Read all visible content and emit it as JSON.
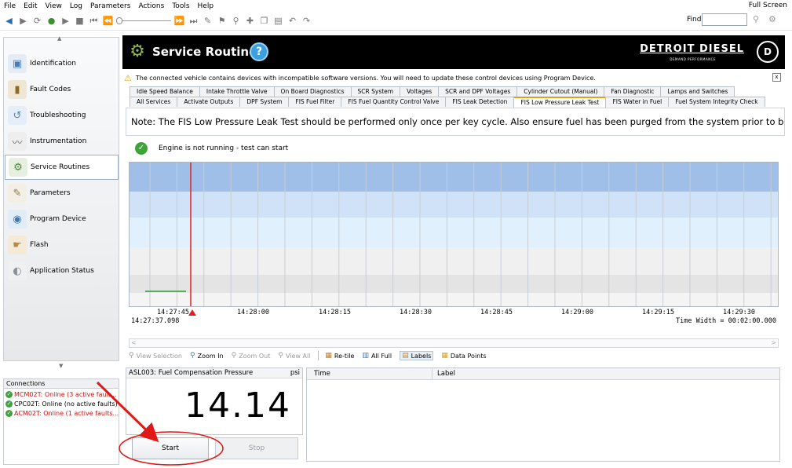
{
  "menu": {
    "items": [
      "File",
      "Edit",
      "View",
      "Log",
      "Parameters",
      "Actions",
      "Tools",
      "Help"
    ],
    "full_screen": "Full Screen"
  },
  "toolbar": {
    "find_label": "Find",
    "find_value": ""
  },
  "sidebar": {
    "items": [
      {
        "label": "Identification",
        "icon": "identification-icon"
      },
      {
        "label": "Fault Codes",
        "icon": "fault-codes-icon"
      },
      {
        "label": "Troubleshooting",
        "icon": "troubleshooting-icon"
      },
      {
        "label": "Instrumentation",
        "icon": "instrumentation-icon"
      },
      {
        "label": "Service Routines",
        "icon": "service-routines-icon",
        "selected": true
      },
      {
        "label": "Parameters",
        "icon": "parameters-icon"
      },
      {
        "label": "Program Device",
        "icon": "program-device-icon"
      },
      {
        "label": "Flash",
        "icon": "flash-icon"
      },
      {
        "label": "Application Status",
        "icon": "application-status-icon"
      }
    ]
  },
  "connections": {
    "title": "Connections",
    "items": [
      {
        "text": "MCM02T: Online (3 active fault...",
        "color": "#d01010"
      },
      {
        "text": "CPC02T: Online (no active faults)",
        "color": "#000000"
      },
      {
        "text": "ACM02T: Online (1 active faults...",
        "color": "#d01010"
      }
    ]
  },
  "header": {
    "title": "Service Routines",
    "help": "?",
    "brand": "DETROIT DIESEL",
    "tagline": "DEMAND PERFORMANCE"
  },
  "warning": {
    "text": "The connected vehicle contains devices with incompatible software versions.  You will need to update these control devices using Program Device.",
    "close": "x"
  },
  "tabs": {
    "row1": [
      "Idle Speed Balance",
      "Intake Throttle Valve",
      "On Board Diagnostics",
      "SCR System",
      "Voltages",
      "SCR and DPF Voltages",
      "Cylinder Cutout (Manual)",
      "Fan Diagnostic",
      "Lamps and Switches"
    ],
    "row2": [
      "All Services",
      "Activate Outputs",
      "DPF System",
      "FIS Fuel Filter",
      "FIS Fuel Quantity Control Valve",
      "FIS Leak Detection",
      "FIS Low Pressure Leak Test",
      "FIS Water in Fuel",
      "Fuel System Integrity Check"
    ],
    "active": "FIS Low Pressure Leak Test"
  },
  "note": "Note: The FIS Low Pressure Leak Test should be performed only once per key cycle. Also ensure fuel has been purged from the system prior to beginning the test.",
  "status": {
    "text": "Engine is not running - test can start"
  },
  "chart": {
    "ticks": [
      "14:27:45",
      "14:28:00",
      "14:28:15",
      "14:28:30",
      "14:28:45",
      "14:29:00",
      "14:29:15",
      "14:29:30"
    ],
    "start_time": "14:27:37.098",
    "time_width": "Time Width = 00:02:00.000",
    "bands": [
      "#9fbfe9",
      "#cfe2f8",
      "#e0f1fd",
      "#f0f0f0",
      "#e4e4e4",
      "#f4f4f4"
    ],
    "marker_color": "#e02020",
    "trace_color": "#2e9a2e"
  },
  "chart_toolbar": {
    "view_selection": "View Selection",
    "zoom_in": "Zoom In",
    "zoom_out": "Zoom Out",
    "view_all": "View All",
    "retile": "Re-tile",
    "all_full": "All Full",
    "labels": "Labels",
    "data_points": "Data Points"
  },
  "gauge": {
    "name": "ASL003: Fuel Compensation Pressure",
    "unit": "psi",
    "value": "14.14"
  },
  "buttons": {
    "start": "Start",
    "stop": "Stop"
  },
  "labels_grid": {
    "col_time": "Time",
    "col_label": "Label"
  }
}
